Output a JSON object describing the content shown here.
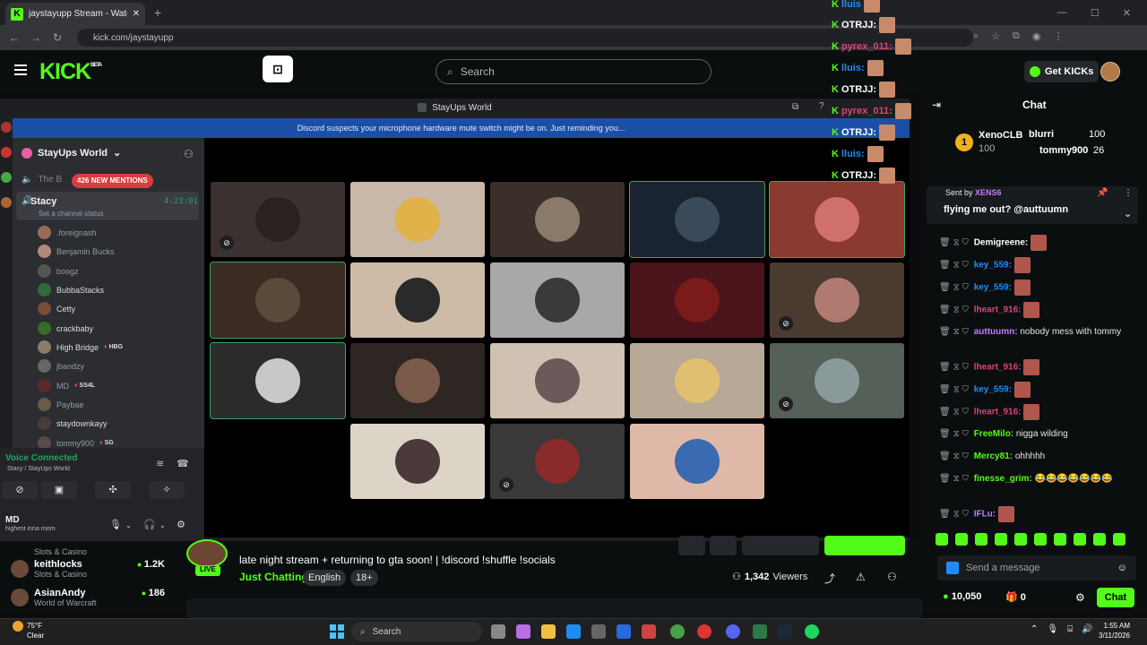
{
  "browser": {
    "tab_title": "jaystayupp Stream - Watch Live",
    "url": "kick.com/jaystayupp"
  },
  "kick": {
    "logo": "KICK",
    "logo_sup": "BETA",
    "search_placeholder": "Search",
    "get_kicks": "Get KICKs",
    "colors": {
      "brand": "#53fc18",
      "bg": "#0b0e0f"
    }
  },
  "sidebar": {
    "channels": [
      {
        "name": "",
        "category": "Slots & Casino",
        "viewers": ""
      },
      {
        "name": "keithlocks",
        "category": "Slots & Casino",
        "viewers": "1.2K"
      },
      {
        "name": "AsianAndy",
        "category": "World of Warcraft",
        "viewers": "186"
      }
    ]
  },
  "stream": {
    "title": "late night stream + returning to gta soon! | !discord !shuffle !socials",
    "category": "Just Chatting",
    "tags": [
      "English",
      "18+"
    ],
    "viewers": "1,342",
    "viewers_label": "Viewers",
    "live_badge": "LIVE"
  },
  "discord": {
    "window_title": "StayUps World",
    "banner": "Discord suspects your microphone hardware mute switch might be on. Just reminding you...",
    "server_name": "StayUps World",
    "channel_above": "The B",
    "mentions": "426 NEW MENTIONS",
    "voice_channel": {
      "name": "Stacy",
      "status": "Set a channel status",
      "time": "4:23:01"
    },
    "users": [
      {
        "name": ".foreignash",
        "dim": true,
        "tag": "",
        "color": "#9b6b5a"
      },
      {
        "name": "Benjamin Bucks",
        "dim": true,
        "tag": "",
        "color": "#b08a7a"
      },
      {
        "name": "boogz",
        "dim": true,
        "tag": "",
        "color": "#555"
      },
      {
        "name": "BubbaStacks",
        "dim": false,
        "tag": "",
        "color": "#2e6b3a"
      },
      {
        "name": "Cetty",
        "dim": false,
        "tag": "",
        "color": "#7a4a3a"
      },
      {
        "name": "crackbaby",
        "dim": false,
        "tag": "",
        "color": "#3a6a2a"
      },
      {
        "name": "High Bridge",
        "dim": false,
        "tag": "HBG",
        "color": "#8a7a6a"
      },
      {
        "name": "jbandzy",
        "dim": true,
        "tag": "",
        "color": "#666"
      },
      {
        "name": "MD",
        "dim": true,
        "tag": "SS4L",
        "color": "#5a2a2a"
      },
      {
        "name": "Paybae",
        "dim": true,
        "tag": "",
        "color": "#6a5a4a"
      },
      {
        "name": "staydownkayy",
        "dim": false,
        "tag": "",
        "color": "#4a3a3a"
      },
      {
        "name": "tommy900",
        "dim": true,
        "tag": "SG",
        "color": "#5a4a4a"
      }
    ],
    "voice_connected": "Voice Connected",
    "voice_path": "Stacy / StayUps World",
    "self_name": "MD",
    "self_status": "highest inna room"
  },
  "video_tiles": [
    {
      "bg": "#3b3130",
      "face": "#2a2220",
      "active": false,
      "muted": true
    },
    {
      "bg": "#c9b7a7",
      "face": "#e0b24a",
      "active": false,
      "muted": false
    },
    {
      "bg": "#3a2f29",
      "face": "#8a7a6a",
      "active": false,
      "muted": false
    },
    {
      "bg": "#1a2430",
      "face": "#3a4a5a",
      "active": true,
      "muted": false
    },
    {
      "bg": "#8a3a2e",
      "face": "#d0706a",
      "active": true,
      "muted": false
    },
    {
      "bg": "#3a2c22",
      "face": "#5a4a3a",
      "active": true,
      "muted": false
    },
    {
      "bg": "#cdbba8",
      "face": "#2a2a2a",
      "active": false,
      "muted": false
    },
    {
      "bg": "#a8a8a8",
      "face": "#3a3a3a",
      "active": false,
      "muted": false
    },
    {
      "bg": "#4a141a",
      "face": "#7a1a1a",
      "active": false,
      "muted": false
    },
    {
      "bg": "#4a3a30",
      "face": "#b07a70",
      "active": false,
      "muted": true
    },
    {
      "bg": "#2b2b2b",
      "face": "#c8c8c8",
      "active": true,
      "muted": false
    },
    {
      "bg": "#2e2622",
      "face": "#7a5a4a",
      "active": false,
      "muted": false
    },
    {
      "bg": "#d0c2b2",
      "face": "#6a5a5a",
      "active": false,
      "muted": false
    },
    {
      "bg": "#b8a898",
      "face": "#e0c070",
      "active": false,
      "muted": false
    },
    {
      "bg": "#546058",
      "face": "#8a9a9a",
      "active": false,
      "muted": true
    },
    {
      "bg": "#ddd4c8",
      "face": "#4a3a3a",
      "active": false,
      "muted": false
    },
    {
      "bg": "#3a3838",
      "face": "#8a2a2a",
      "active": false,
      "muted": true
    },
    {
      "bg": "#e0b8a8",
      "face": "#3a6ab0",
      "active": false,
      "muted": false
    }
  ],
  "overlay_chat": [
    {
      "name": "lluis",
      "color": "#1f8cf5"
    },
    {
      "name": "OTRJJ:",
      "color": "#ffffff"
    },
    {
      "name": "pyrex_011:",
      "color": "#d8427a"
    },
    {
      "name": "lluis:",
      "color": "#1f8cf5"
    },
    {
      "name": "OTRJJ:",
      "color": "#ffffff"
    },
    {
      "name": "pyrex_011:",
      "color": "#d8427a"
    },
    {
      "name": "OTRJJ:",
      "color": "#ffffff"
    },
    {
      "name": "lluis:",
      "color": "#1f8cf5"
    },
    {
      "name": "OTRJJ:",
      "color": "#ffffff"
    }
  ],
  "chat": {
    "title": "Chat",
    "leaderboard": [
      {
        "rank": "1",
        "name": "XenoCLB",
        "amount": "100"
      },
      {
        "name": "blurri",
        "amount": "100"
      },
      {
        "name": "tommy900",
        "amount": "26"
      }
    ],
    "pinned_by_label": "Sent by",
    "pinned_by_user": "XENS6",
    "pinned_message": "flying me out? @auttuumn",
    "messages": [
      {
        "user": "Demigreene:",
        "color": "#ffffff",
        "text": ""
      },
      {
        "user": "key_559:",
        "color": "#1f8cf5",
        "text": ""
      },
      {
        "user": "key_559:",
        "color": "#1f8cf5",
        "text": ""
      },
      {
        "user": "lheart_916:",
        "color": "#d8427a",
        "text": ""
      },
      {
        "user": "auttuumn:",
        "color": "#c27cff",
        "text": "nobody mess with tommy"
      },
      {
        "user": "lheart_916:",
        "color": "#d8427a",
        "text": ""
      },
      {
        "user": "key_559:",
        "color": "#1f8cf5",
        "text": ""
      },
      {
        "user": "lheart_916:",
        "color": "#d8427a",
        "text": ""
      },
      {
        "user": "FreeMilo:",
        "color": "#53fc18",
        "text": "nigga wilding"
      },
      {
        "user": "Mercy81:",
        "color": "#53fc18",
        "text": "ohhhhh"
      },
      {
        "user": "finesse_grim:",
        "color": "#53fc18",
        "text": "😂😂😂😂😂😂😂"
      },
      {
        "user": "IFLu:",
        "color": "#c27cff",
        "text": ""
      }
    ],
    "input_placeholder": "Send a message",
    "points": "10,050",
    "gifts": "0",
    "send_button": "Chat"
  },
  "taskbar": {
    "temp": "75°F",
    "weather": "Clear",
    "search": "Search",
    "time": "1:55 AM",
    "date": "3/11/2026"
  }
}
